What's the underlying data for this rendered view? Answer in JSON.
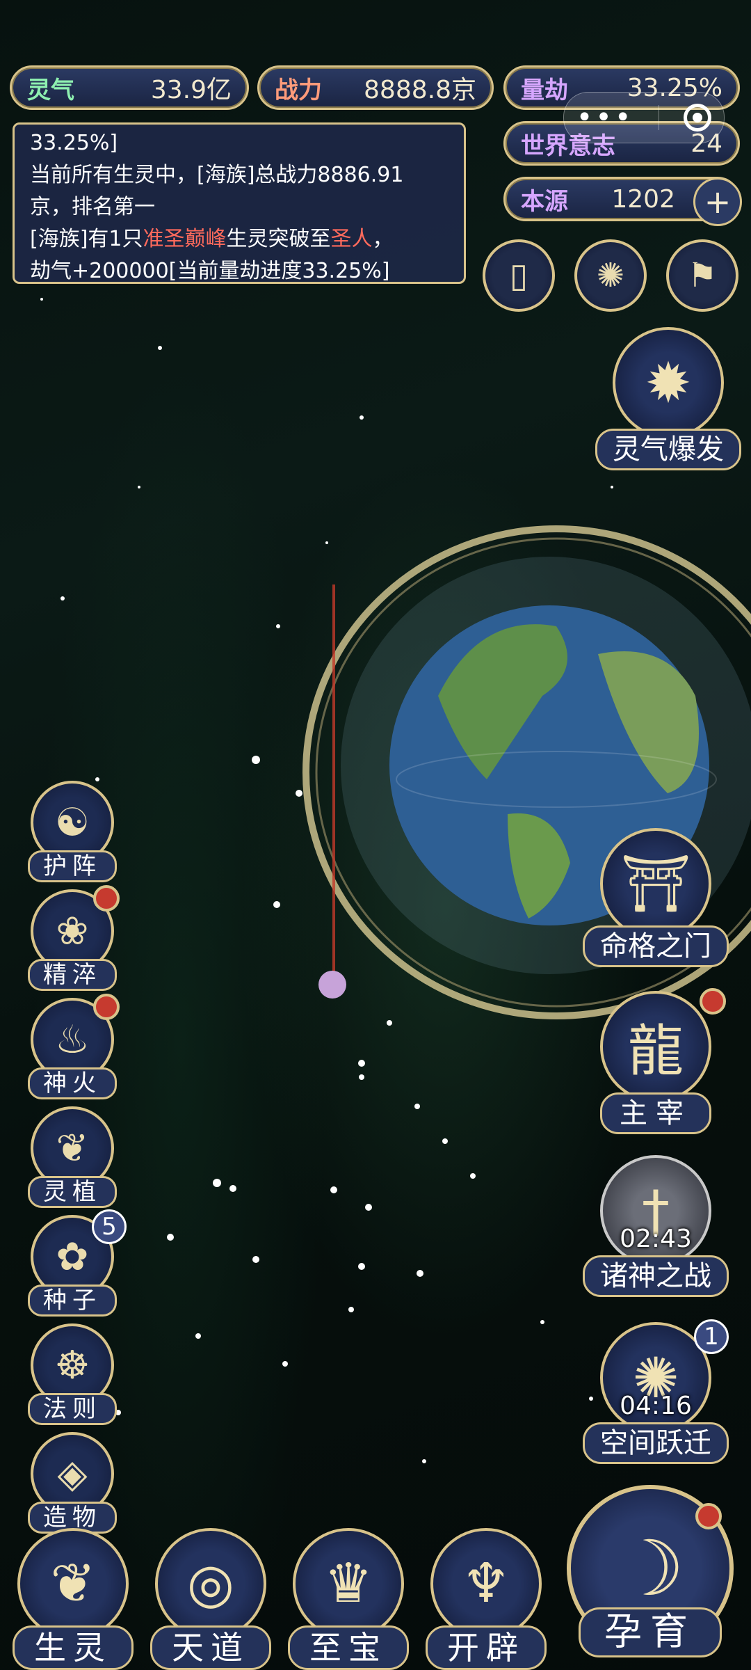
{
  "stats": {
    "lingqi": {
      "label": "灵气",
      "value": "33.9亿"
    },
    "zhanli": {
      "label": "战力",
      "value": "8888.8京"
    },
    "liangjie": {
      "label": "量劫",
      "value": "33.25%"
    },
    "shijieyizhi": {
      "label": "世界意志",
      "value": "24"
    },
    "benyuan": {
      "label": "本源",
      "value": "1202"
    }
  },
  "message": {
    "line0": "33.25%]",
    "line1": "当前所有生灵中，[海族]总战力8886.91",
    "line2": "京，排名第一",
    "line3_pre": "[海族]有1只",
    "line3_red1": "准圣巅峰",
    "line3_mid": "生灵突破至",
    "line3_red2": "圣人",
    "line3_post": "，",
    "line4": "劫气+200000[当前量劫进度33.25%]"
  },
  "left_menu": [
    {
      "label": "护阵",
      "icon": "yin-yang-icon"
    },
    {
      "label": "精淬",
      "icon": "lotus-flame-icon",
      "red_dot": true
    },
    {
      "label": "神火",
      "icon": "fire-icon",
      "red_dot": true
    },
    {
      "label": "灵植",
      "icon": "plant-icon"
    },
    {
      "label": "种子",
      "icon": "flower-icon",
      "badge": "5"
    },
    {
      "label": "法则",
      "icon": "rune-icon"
    },
    {
      "label": "造物",
      "icon": "diamond-icon"
    }
  ],
  "right_menu": {
    "lingqi_baofa": "灵气爆发",
    "mingge_zhimen": "命格之门",
    "zhuzai": "主宰",
    "zhushen_zhizhan": "诸神之战",
    "zhushen_timer": "02:43",
    "kongjian_yueqian": "空间跃迁",
    "kongjian_timer": "04:16",
    "kongjian_badge": "1"
  },
  "bottom_nav": [
    "生灵",
    "天道",
    "至宝",
    "开辟"
  ],
  "main_button": "孕育",
  "colors": {
    "gold": "#d8c38a",
    "panel": "#24325a",
    "red_text": "#ff6a5c"
  }
}
